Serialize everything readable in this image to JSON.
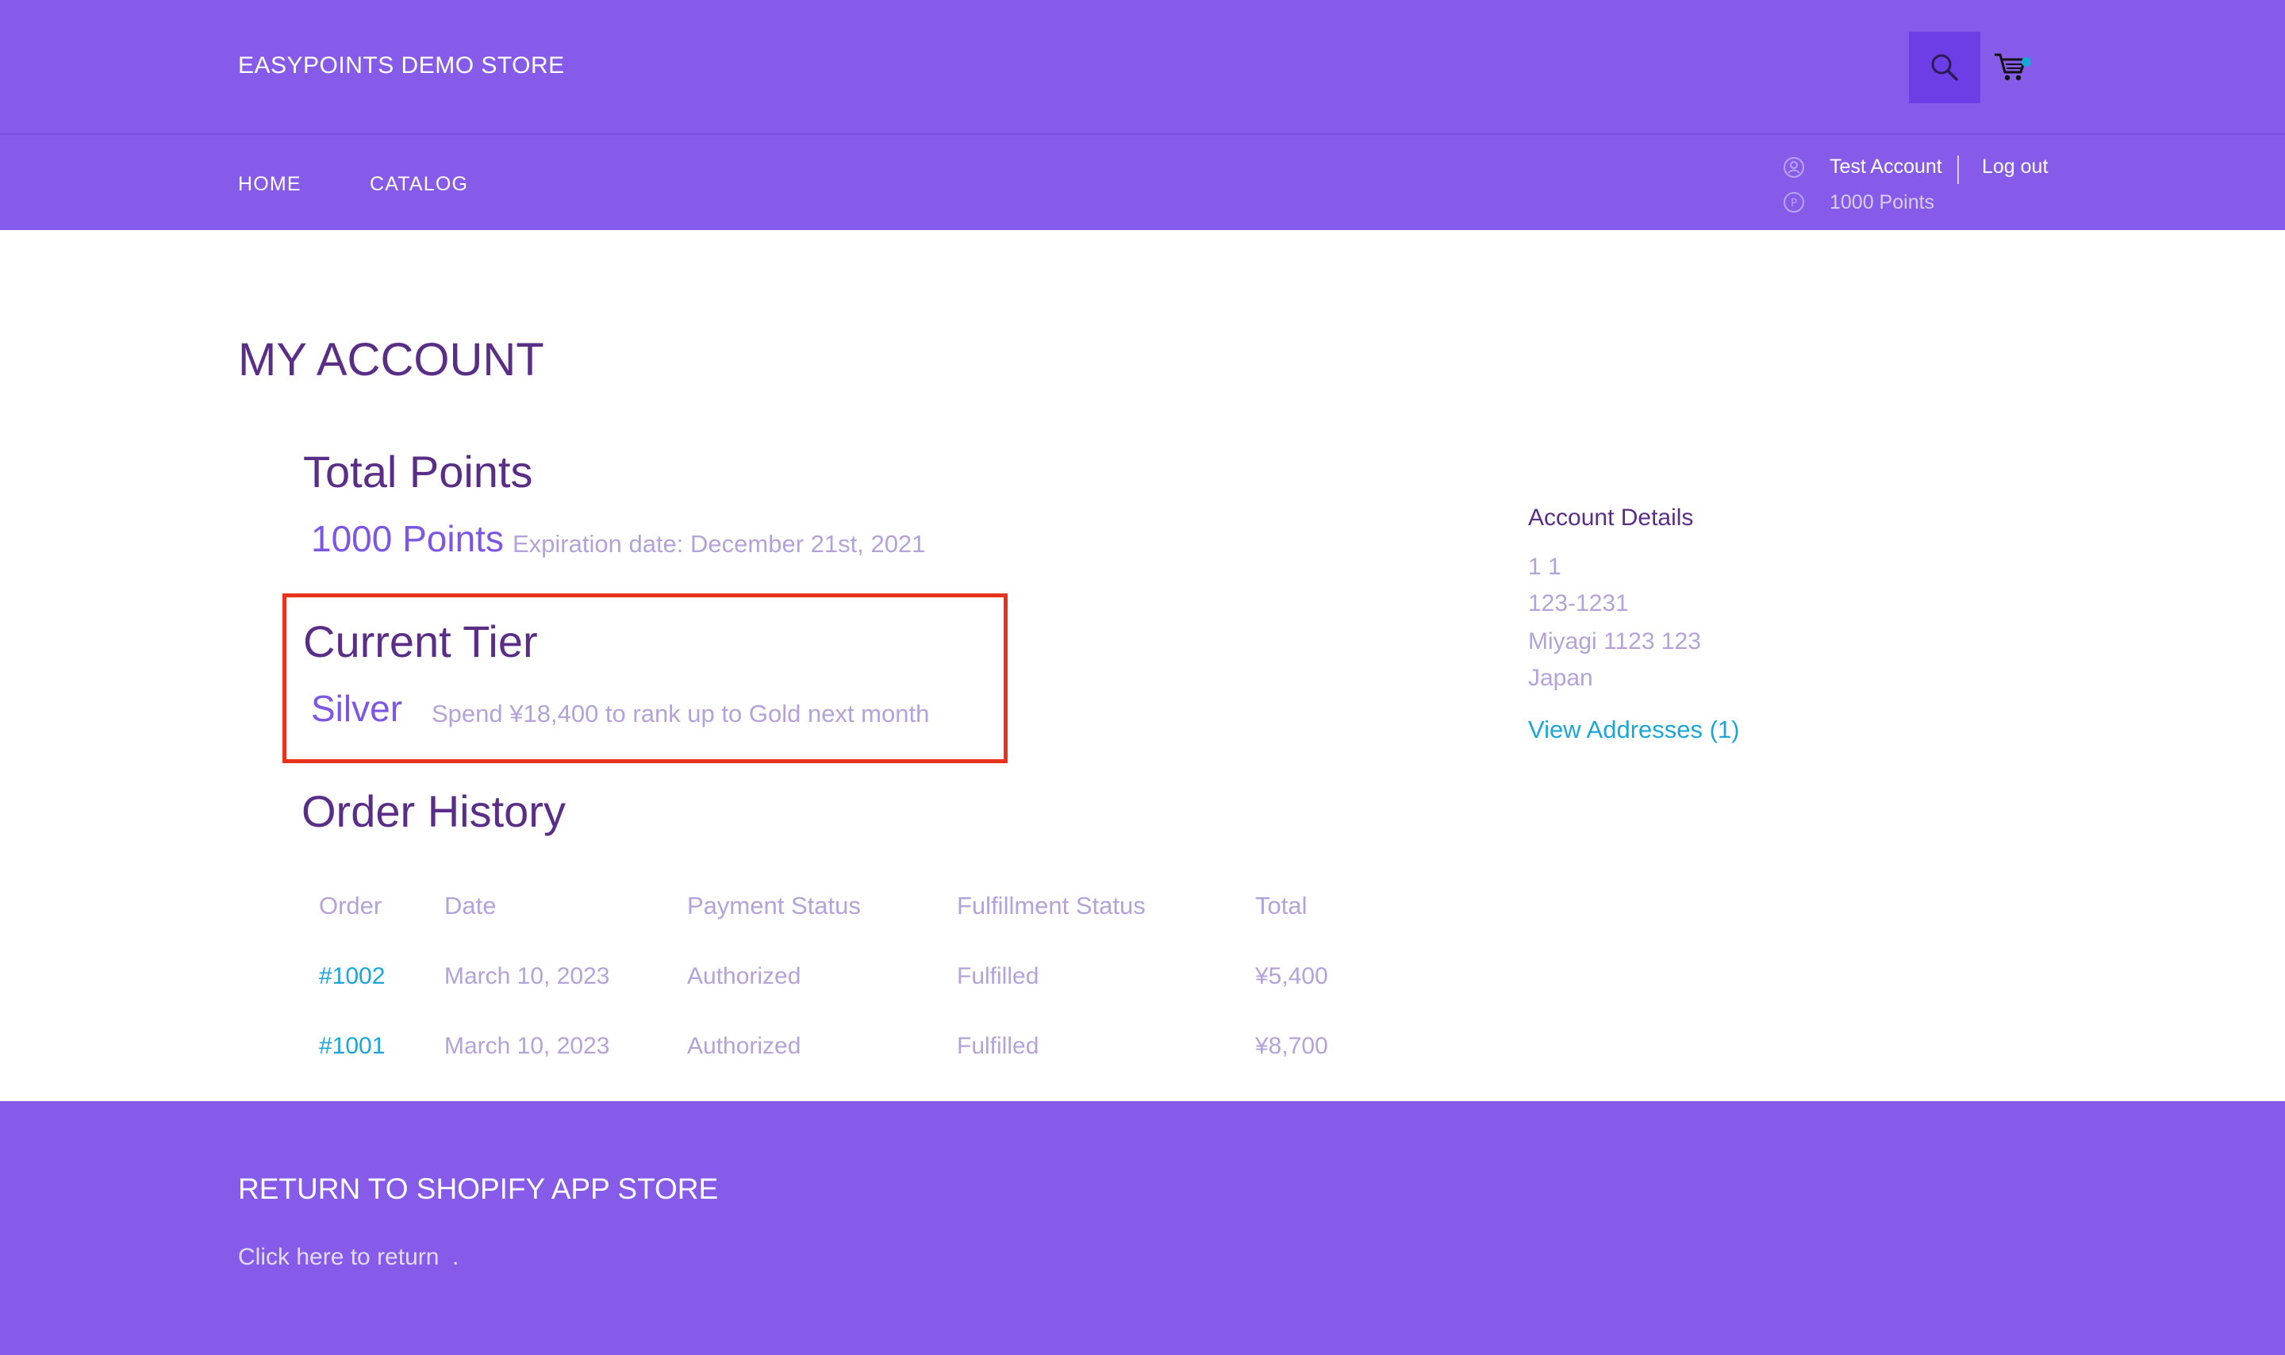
{
  "header": {
    "store_name": "EASYPOINTS DEMO STORE",
    "icons": [
      "search-icon",
      "cart-icon"
    ]
  },
  "nav": {
    "home": "HOME",
    "catalog": "CATALOG"
  },
  "account_bar": {
    "name": "Test Account",
    "logout": "Log out",
    "points": "1000 Points",
    "icons": [
      "user-icon",
      "coin-icon"
    ]
  },
  "main": {
    "page_title": "MY ACCOUNT",
    "total_points": {
      "title": "Total Points",
      "value": "1000 Points",
      "expiry": "Expiration date: December 21st, 2021"
    },
    "current_tier": {
      "title": "Current Tier",
      "value": "Silver",
      "note": "Spend ¥18,400 to rank up to Gold next month"
    },
    "order_history": {
      "title": "Order History",
      "columns": [
        "Order",
        "Date",
        "Payment Status",
        "Fulfillment Status",
        "Total"
      ],
      "rows": [
        [
          "#1002",
          "March 10, 2023",
          "Authorized",
          "Fulfilled",
          "¥5,400"
        ],
        [
          "#1001",
          "March 10, 2023",
          "Authorized",
          "Fulfilled",
          "¥8,700"
        ]
      ]
    }
  },
  "account_details": {
    "title": "Account Details",
    "address_lines": [
      "1 1",
      "123-1231",
      "Miyagi 1123 123",
      "Japan"
    ],
    "view_addresses": "View Addresses (1)"
  },
  "footer": {
    "title": "RETURN TO SHOPIFY APP STORE",
    "link": "Click here to return",
    "trailing": "."
  },
  "colors": {
    "brand_purple": "#865BEA",
    "search_button": "#6D3DE5",
    "heading_purple": "#5A2E87",
    "accent_purple": "#7E56E6",
    "link_blue": "#1AA7D8",
    "highlight_red": "#E8321C"
  }
}
